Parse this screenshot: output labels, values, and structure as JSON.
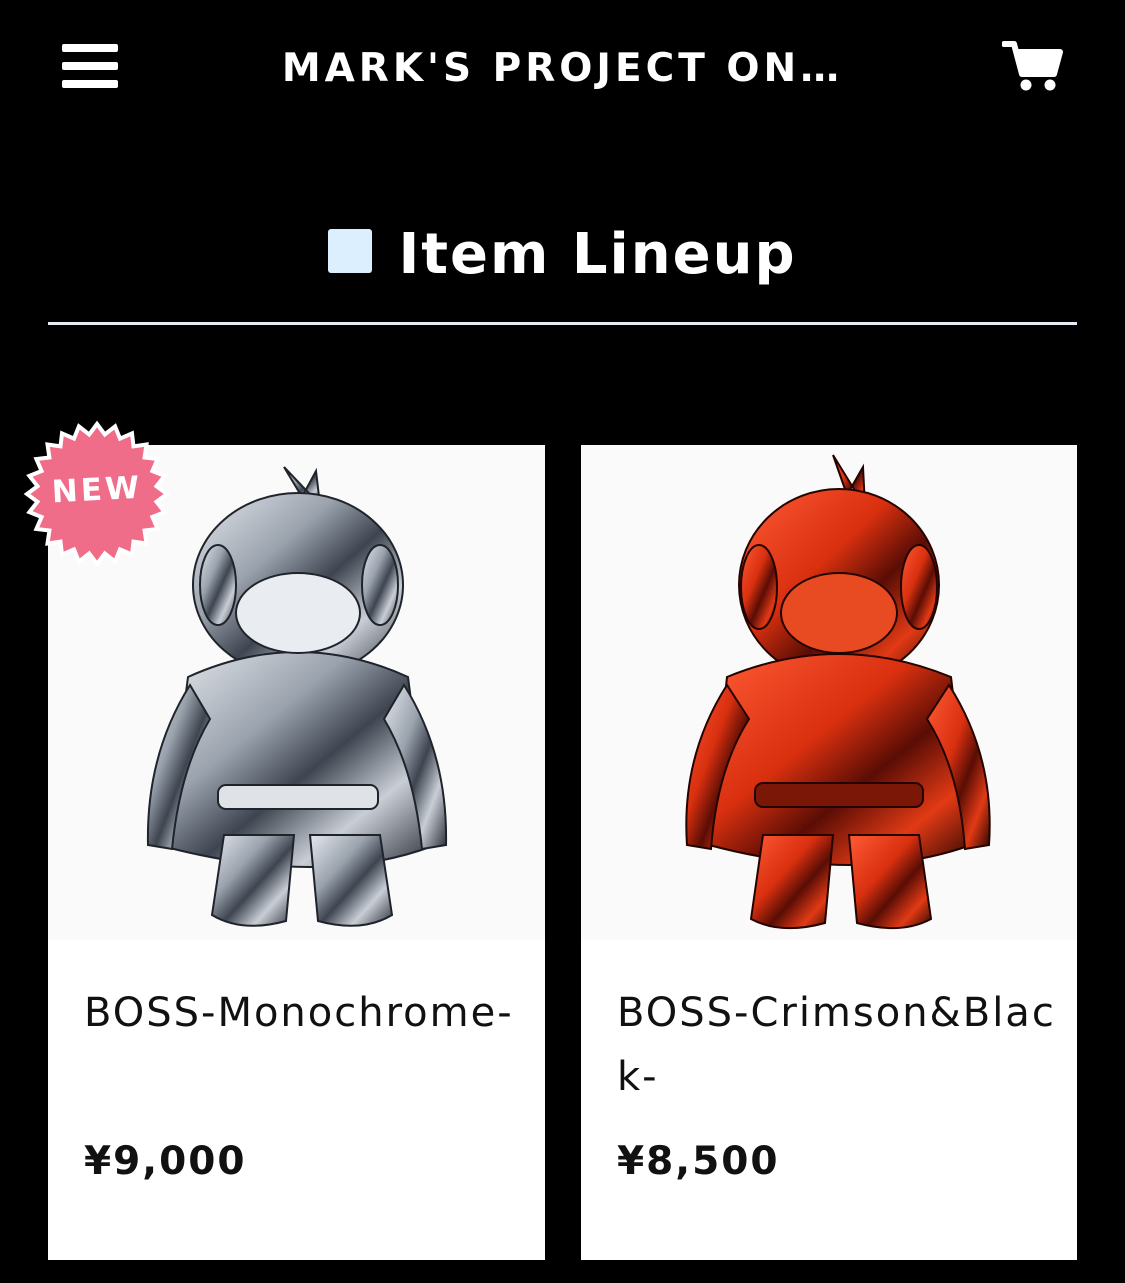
{
  "header": {
    "title": "MARK'S PROJECT ON…",
    "menu_icon": "hamburger-menu-icon",
    "cart_icon": "shopping-cart-icon"
  },
  "section": {
    "heading": "Item Lineup",
    "heading_marker_color": "#dcefff"
  },
  "badge": {
    "label": "NEW",
    "color": "#f06d8a"
  },
  "products": [
    {
      "name": "BOSS-Monochrome-",
      "price": "¥9,000",
      "badge": "NEW"
    },
    {
      "name": "BOSS-Crimson&Black-",
      "price": "¥8,500"
    }
  ]
}
